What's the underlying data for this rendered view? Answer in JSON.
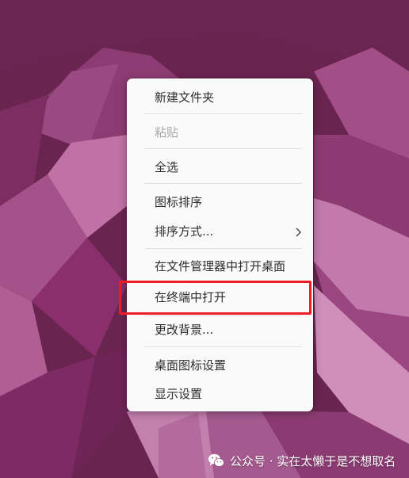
{
  "desktop": {
    "wallpaper_colors": [
      "#6b2a52",
      "#7a2d5e",
      "#8a356a",
      "#a24a80",
      "#c06a9c",
      "#5c1f47"
    ]
  },
  "context_menu": {
    "items": [
      {
        "label": "新建文件夹",
        "disabled": false
      },
      {
        "label": "粘贴",
        "disabled": true
      },
      {
        "label": "全选",
        "disabled": false
      },
      {
        "label": "图标排序",
        "disabled": false
      },
      {
        "label": "排序方式...",
        "disabled": false,
        "submenu_icon": "chevron-right-icon"
      },
      {
        "label": "在文件管理器中打开桌面",
        "disabled": false
      },
      {
        "label": "在终端中打开",
        "disabled": false,
        "highlighted": true
      },
      {
        "label": "更改背景...",
        "disabled": false
      },
      {
        "label": "桌面图标设置",
        "disabled": false
      },
      {
        "label": "显示设置",
        "disabled": false
      }
    ],
    "highlight_color": "#ee1c25"
  },
  "watermark": {
    "text": "公众号 · 实在太懒于是不想取名",
    "icon": "wechat-icon"
  }
}
